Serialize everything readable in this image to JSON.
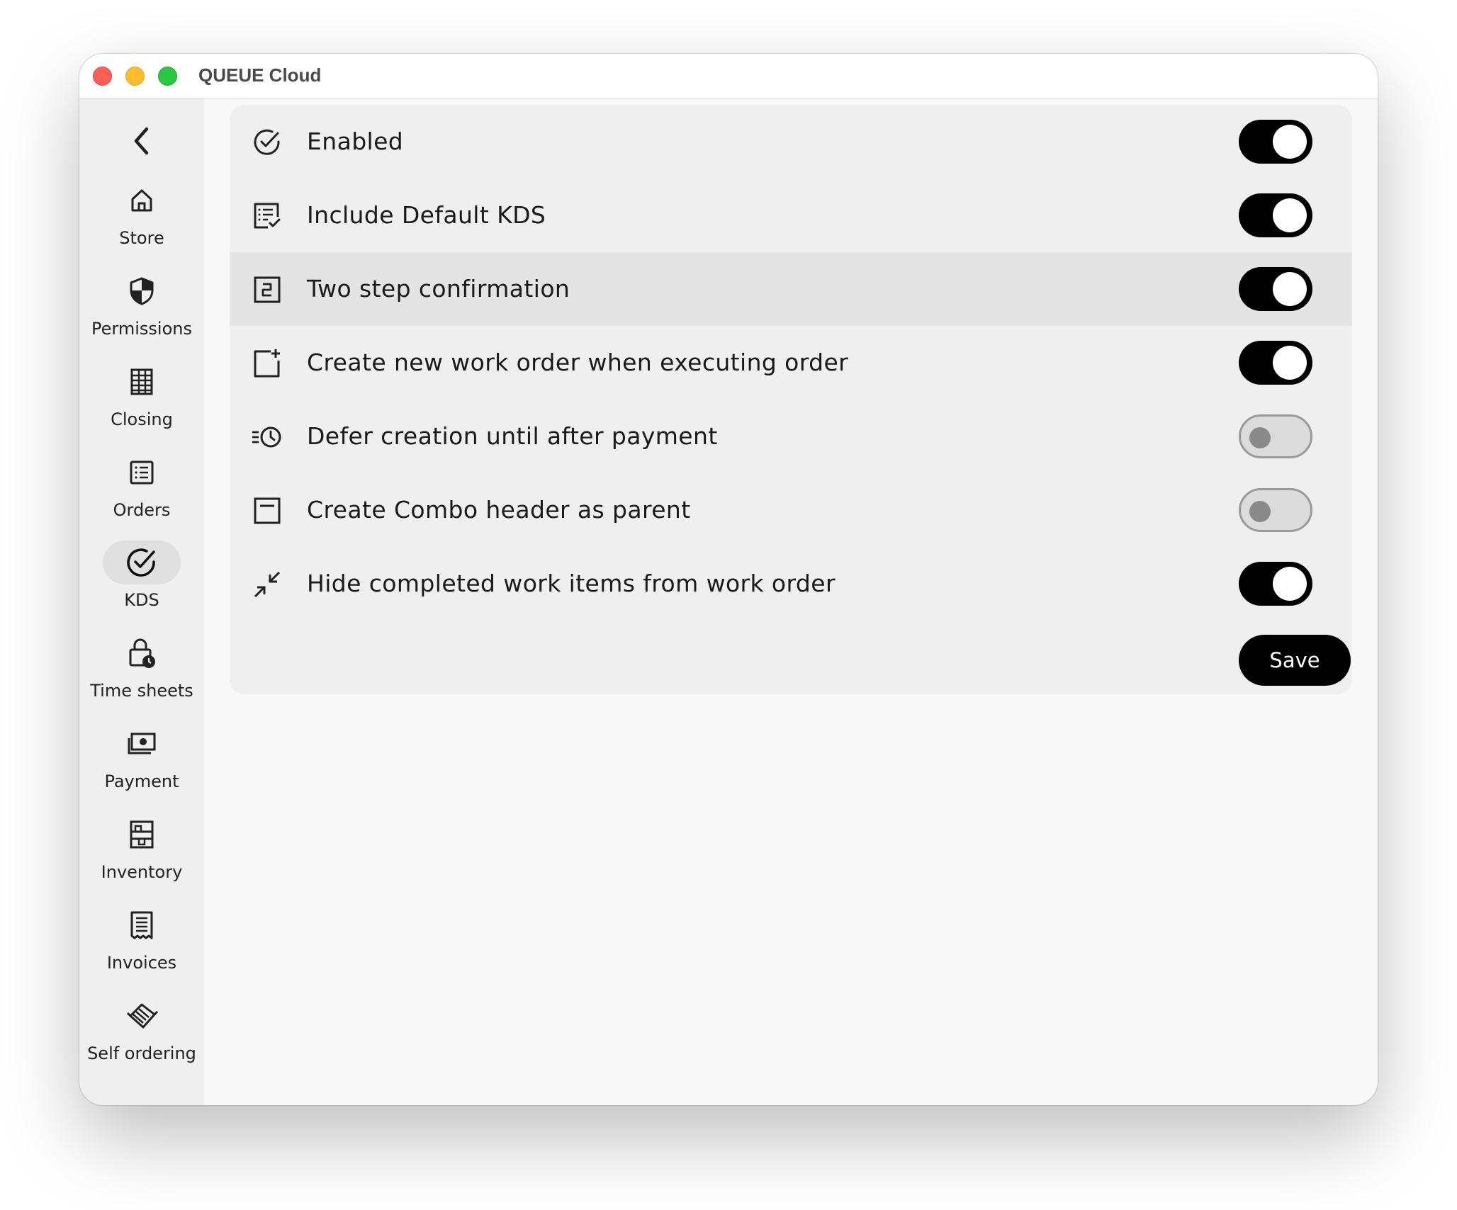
{
  "window": {
    "title": "QUEUE Cloud"
  },
  "sidebar": {
    "back_icon": "chevron-left-icon",
    "items": [
      {
        "label": "Store",
        "icon": "home-icon",
        "active": false
      },
      {
        "label": "Permissions",
        "icon": "shield-icon",
        "active": false
      },
      {
        "label": "Closing",
        "icon": "ledger-icon",
        "active": false
      },
      {
        "label": "Orders",
        "icon": "list-icon",
        "active": false
      },
      {
        "label": "KDS",
        "icon": "check-circle-icon",
        "active": true
      },
      {
        "label": "Time sheets",
        "icon": "lock-clock-icon",
        "active": false
      },
      {
        "label": "Payment",
        "icon": "cash-icon",
        "active": false
      },
      {
        "label": "Inventory",
        "icon": "warehouse-icon",
        "active": false
      },
      {
        "label": "Invoices",
        "icon": "receipt-icon",
        "active": false
      },
      {
        "label": "Self ordering",
        "icon": "handshake-icon",
        "active": false
      }
    ]
  },
  "settings": {
    "rows": [
      {
        "label": "Enabled",
        "icon": "check-circle-icon",
        "enabled": true
      },
      {
        "label": "Include Default KDS",
        "icon": "list-check-icon",
        "enabled": true
      },
      {
        "label": "Two step confirmation",
        "icon": "number-two-box-icon",
        "enabled": true
      },
      {
        "label": "Create new work order when executing order",
        "icon": "add-document-icon",
        "enabled": true
      },
      {
        "label": "Defer creation until after payment",
        "icon": "clock-lines-icon",
        "enabled": false
      },
      {
        "label": "Create Combo header as parent",
        "icon": "header-box-icon",
        "enabled": false
      },
      {
        "label": "Hide completed work items from work order",
        "icon": "collapse-arrows-icon",
        "enabled": true
      }
    ],
    "save_label": "Save"
  },
  "colors": {
    "toggle_on": "#000000",
    "toggle_off": "#dcdcdc",
    "active_nav_bg": "#e0e0e0",
    "panel_bg": "#efefef",
    "highlight_row_bg": "#e4e4e4"
  }
}
